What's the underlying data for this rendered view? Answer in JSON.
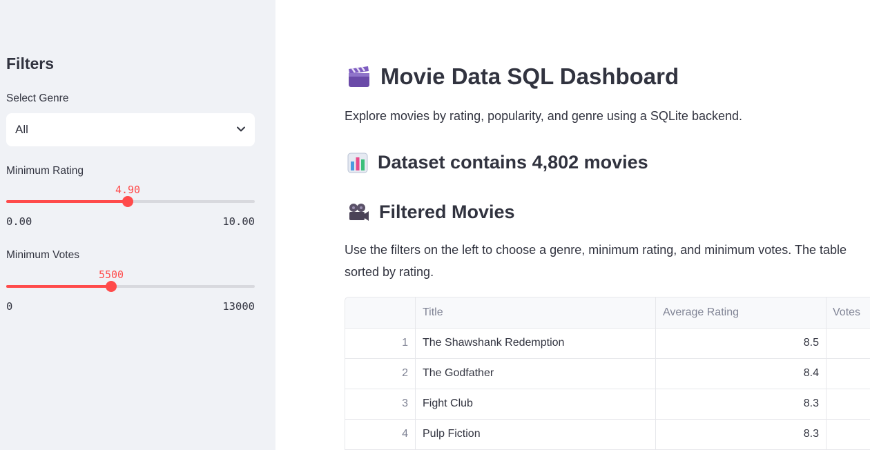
{
  "sidebar": {
    "heading": "Filters",
    "genre": {
      "label": "Select Genre",
      "value": "All"
    },
    "rating": {
      "label": "Minimum Rating",
      "value": "4.90",
      "min": "0.00",
      "max": "10.00",
      "fraction": 0.49
    },
    "votes": {
      "label": "Minimum Votes",
      "value": "5500",
      "min": "0",
      "max": "13000",
      "fraction": 0.423
    }
  },
  "main": {
    "title": "Movie Data SQL Dashboard",
    "title_icon": "clapper-board-icon",
    "intro": "Explore movies by rating, popularity, and genre using a SQLite backend.",
    "dataset": {
      "icon": "bar-chart-icon",
      "text": "Dataset contains 4,802 movies"
    },
    "filtered": {
      "icon": "movie-camera-icon",
      "text": "Filtered Movies"
    },
    "description_line1": "Use the filters on the left to choose a genre, minimum rating, and minimum votes. The table",
    "description_line2": "sorted by rating."
  },
  "table": {
    "columns": {
      "title": "Title",
      "rating": "Average Rating",
      "votes": "Votes"
    },
    "rows": [
      {
        "idx": "1",
        "title": "The Shawshank Redemption",
        "rating": "8.5"
      },
      {
        "idx": "2",
        "title": "The Godfather",
        "rating": "8.4"
      },
      {
        "idx": "3",
        "title": "Fight Club",
        "rating": "8.3"
      },
      {
        "idx": "4",
        "title": "Pulp Fiction",
        "rating": "8.3"
      }
    ]
  },
  "colors": {
    "accent": "#ff4b4b",
    "sidebar_bg": "#f0f2f6",
    "text": "#31333f"
  }
}
